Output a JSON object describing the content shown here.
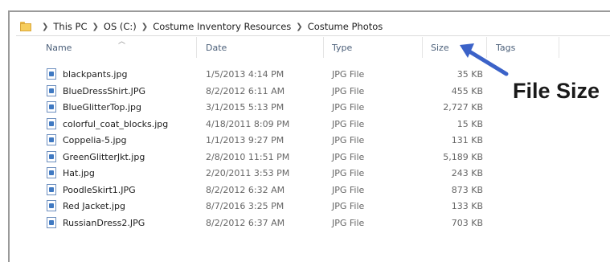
{
  "breadcrumb": [
    "This PC",
    "OS (C:)",
    "Costume Inventory Resources",
    "Costume Photos"
  ],
  "columns": {
    "name": "Name",
    "date": "Date",
    "type": "Type",
    "size": "Size",
    "tags": "Tags"
  },
  "files": [
    {
      "name": "blackpants.jpg",
      "date": "1/5/2013 4:14 PM",
      "type": "JPG File",
      "size": "35 KB"
    },
    {
      "name": "BlueDressShirt.JPG",
      "date": "8/2/2012 6:11 AM",
      "type": "JPG File",
      "size": "455 KB"
    },
    {
      "name": "BlueGlitterTop.jpg",
      "date": "3/1/2015 5:13 PM",
      "type": "JPG File",
      "size": "2,727 KB"
    },
    {
      "name": "colorful_coat_blocks.jpg",
      "date": "4/18/2011 8:09 PM",
      "type": "JPG File",
      "size": "15 KB"
    },
    {
      "name": "Coppelia-5.jpg",
      "date": "1/1/2013 9:27 PM",
      "type": "JPG File",
      "size": "131 KB"
    },
    {
      "name": "GreenGlitterJkt.jpg",
      "date": "2/8/2010 11:51 PM",
      "type": "JPG File",
      "size": "5,189 KB"
    },
    {
      "name": "Hat.jpg",
      "date": "2/20/2011 3:53 PM",
      "type": "JPG File",
      "size": "243 KB"
    },
    {
      "name": "PoodleSkirt1.JPG",
      "date": "8/2/2012 6:32 AM",
      "type": "JPG File",
      "size": "873 KB"
    },
    {
      "name": "Red Jacket.jpg",
      "date": "8/7/2016 3:25 PM",
      "type": "JPG File",
      "size": "133 KB"
    },
    {
      "name": "RussianDress2.JPG",
      "date": "8/2/2012 6:37 AM",
      "type": "JPG File",
      "size": "703 KB"
    }
  ],
  "annotation": {
    "label": "File Size",
    "color": "#3b62c8"
  }
}
